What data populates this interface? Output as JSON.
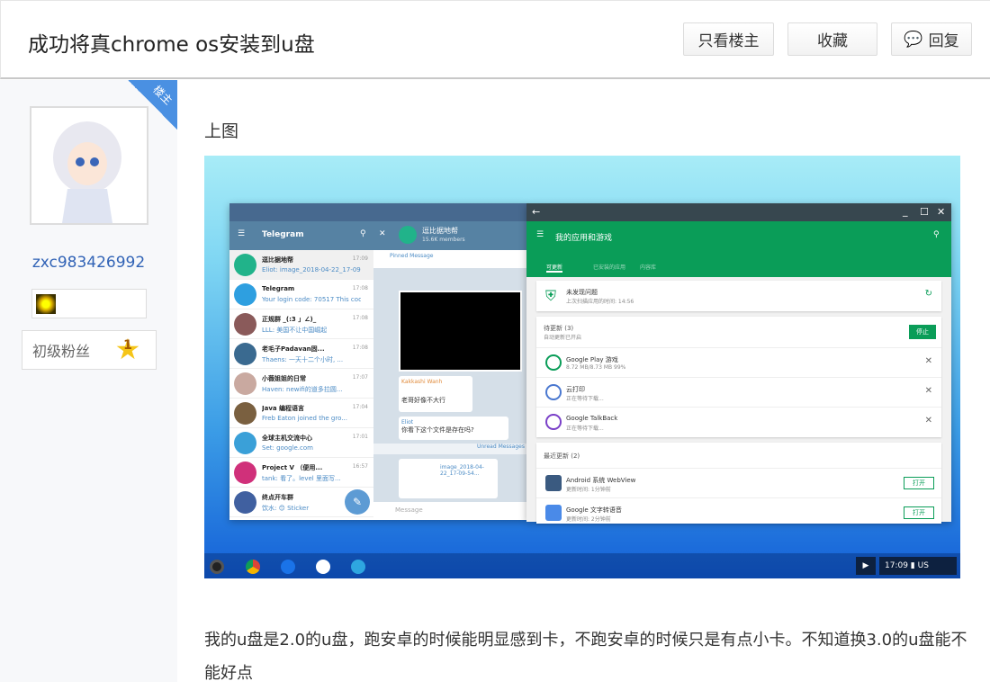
{
  "header": {
    "title": "成功将真chrome os安装到u盘",
    "buttons": {
      "only_op": "只看楼主",
      "favorite": "收藏",
      "reply": "回复"
    }
  },
  "author": {
    "badge": "楼主",
    "username": "zxc983426992",
    "fan_level": "初级粉丝",
    "level": "1"
  },
  "post": {
    "caption": "上图",
    "text": "我的u盘是2.0的u盘，跑安卓的时候能明显感到卡，不跑安卓的时候只是有点小卡。不知道换3.0的u盘能不能好点"
  },
  "screenshot": {
    "telegram": {
      "title": "Telegram",
      "chat_title": "逗比据地帮",
      "members": "15.6K members",
      "pinned": "Pinned Message",
      "message_placeholder": "Message",
      "msg1_sender": "Kakkashi Wanh",
      "msg1": "老哥好像不大行",
      "msg2_sender": "Eliot",
      "msg2": "你看下这个文件是存在吗?",
      "file": "image_2018-04-22_17-09-54...",
      "unread": "Unread Messages",
      "chats": [
        {
          "name": "逗比据地帮",
          "msg": "Eliot: image_2018-04-22_17-09-5...",
          "time": "17:09",
          "color": "#21b38a"
        },
        {
          "name": "Telegram",
          "msg": "Your login code: 70517  This cod...",
          "time": "17:08",
          "color": "#2e9fe0"
        },
        {
          "name": "正规群 _(:3 」∠)_",
          "msg": "LLL: 美国不让中国崛起",
          "time": "17:08",
          "color": "#8a5a5a"
        },
        {
          "name": "老毛子Padavan固...",
          "msg": "Thaens: 一天十二个小时, ...",
          "time": "17:08",
          "color": "#3a6a90"
        },
        {
          "name": "小薇姐姐的日常",
          "msg": "Haven: newifi的道多拉圆...",
          "time": "17:07",
          "color": "#c9a9a0"
        },
        {
          "name": "Java 编程语言",
          "msg": "Freb Eaton joined the gro...",
          "time": "17:04",
          "color": "#7a6040"
        },
        {
          "name": "全球主机交流中心",
          "msg": "Set: google.com",
          "time": "17:01",
          "color": "#3aa0d8"
        },
        {
          "name": "Project V （便用...",
          "msg": "tank: 看了。level 里面写...",
          "time": "16:57",
          "color": "#d0307a"
        },
        {
          "name": "终点开车群",
          "msg": "饮水: 😊 Sticker",
          "time": "",
          "color": "#4060a0"
        }
      ]
    },
    "play": {
      "title": "我的应用和游戏",
      "tabs": [
        "可更新",
        "已安装的应用",
        "内容库"
      ],
      "security": {
        "title": "未发现问题",
        "sub": "上次扫描应用的时间: 14:56"
      },
      "pending": {
        "title": "待更新 (3)",
        "sub": "自动更新已开启",
        "stop": "停止"
      },
      "pending_items": [
        {
          "name": "Google Play 游戏",
          "sub": "8.72 MB/8.73 MB  99%",
          "color": "#0a9d58"
        },
        {
          "name": "云打印",
          "sub": "正在等待下载...",
          "color": "#4a78d0"
        },
        {
          "name": "Google TalkBack",
          "sub": "正在等待下载...",
          "color": "#7a40c8"
        }
      ],
      "recent": {
        "title": "最近更新 (2)",
        "open": "打开"
      },
      "recent_items": [
        {
          "name": "Android 系统 WebView",
          "sub": "更新时间: 1分钟前",
          "color": "#3a5a80"
        },
        {
          "name": "Google 文字转语音",
          "sub": "更新时间: 2分钟前",
          "color": "#4a8ae8"
        }
      ]
    },
    "shelf": {
      "time": "17:09",
      "lang": "US"
    }
  },
  "colors": {
    "link": "#3163b6",
    "play_green": "#0a9d58",
    "badge_blue": "#4a90e2"
  }
}
